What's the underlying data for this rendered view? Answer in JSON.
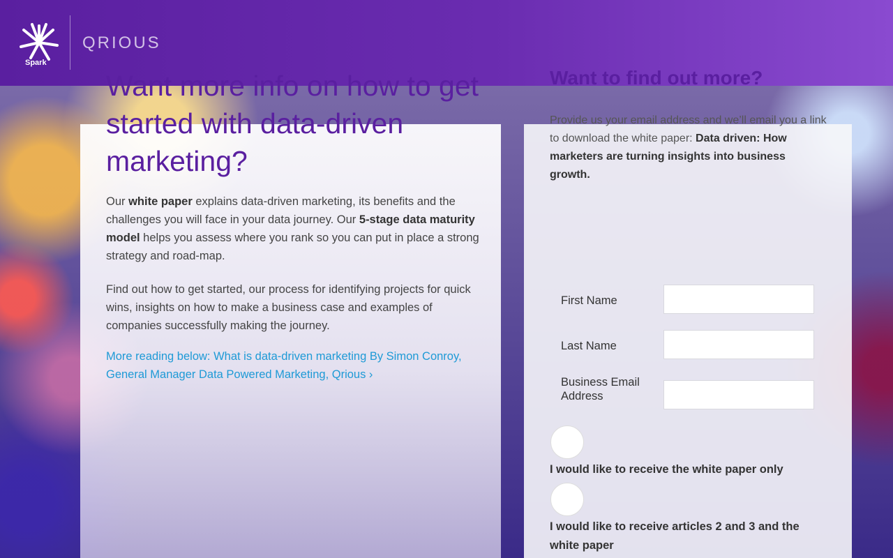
{
  "header": {
    "logo_small_text": "Spark",
    "brand": "QRIOUS"
  },
  "left": {
    "headline": "Want more info on how to get started with data-driven marketing?",
    "para1": {
      "s1": "Our ",
      "b1": "white paper",
      "s2": " explains data-driven marketing, its benefits and the challenges you will face in your data journey. Our ",
      "b2": "5-stage data maturity model",
      "s3": " helps you assess where you rank so you can put in place a strong strategy and road-map."
    },
    "para2": "Find out how to get started, our process for identifying projects for quick wins, insights on how to make a business case and examples of companies successfully making the journey.",
    "link": "More reading below: What is data-driven marketing By Simon Conroy, General Manager Data Powered Marketing, Qrious ›"
  },
  "form": {
    "title": "Want to find out more?",
    "intro_plain": "Provide us your email address and we’ll email you a link to download the white paper: ",
    "intro_bold": "Data driven: How marketers are turning insights into business growth.",
    "fields": [
      {
        "label": "First Name",
        "value": ""
      },
      {
        "label": "Last Name",
        "value": ""
      },
      {
        "label": "Business Email Address",
        "value": ""
      }
    ],
    "options": [
      {
        "label": "I would like to receive the white paper only",
        "selected": false
      },
      {
        "label": "I would like to receive articles 2 and 3 and the white paper",
        "selected": false
      }
    ]
  }
}
